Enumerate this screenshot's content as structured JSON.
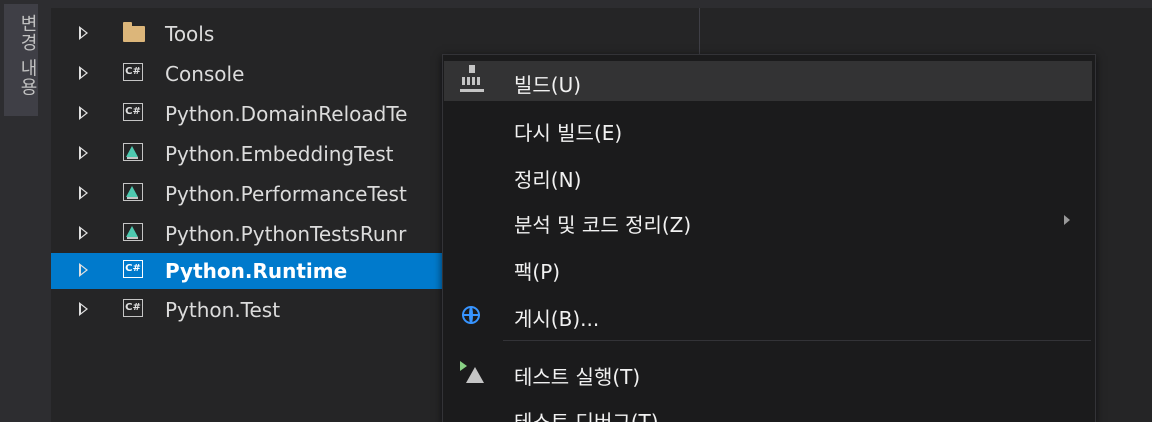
{
  "vertical_tab": {
    "label": "변경 내용"
  },
  "tree": {
    "items": [
      {
        "label": "Tools",
        "icon": "folder-icon",
        "selected": false
      },
      {
        "label": "Console",
        "icon": "csharp-project-icon",
        "selected": false
      },
      {
        "label": "Python.DomainReloadTe",
        "icon": "csharp-project-icon",
        "selected": false
      },
      {
        "label": "Python.EmbeddingTest",
        "icon": "test-project-icon",
        "selected": false
      },
      {
        "label": "Python.PerformanceTest",
        "icon": "test-project-icon",
        "selected": false
      },
      {
        "label": "Python.PythonTestsRunr",
        "icon": "test-project-icon",
        "selected": false
      },
      {
        "label": "Python.Runtime",
        "icon": "csharp-project-icon",
        "selected": true
      },
      {
        "label": "Python.Test",
        "icon": "csharp-project-icon",
        "selected": false
      }
    ],
    "csharp_badge": "C#"
  },
  "context_menu": {
    "items": [
      {
        "label": "빌드(U)",
        "icon": "build-icon",
        "highlighted": true
      },
      {
        "label": "다시 빌드(E)",
        "icon": ""
      },
      {
        "label": "정리(N)",
        "icon": ""
      },
      {
        "label": "분석 및 코드 정리(Z)",
        "icon": "",
        "submenu": true
      },
      {
        "label": "팩(P)",
        "icon": ""
      },
      {
        "label": "게시(B)...",
        "icon": "globe-publish-icon"
      },
      {
        "label": "테스트 실행(T)",
        "icon": "run-tests-icon"
      },
      {
        "label": "테스트 디버그(T)",
        "icon": ""
      }
    ]
  },
  "colors": {
    "selection": "#007acc",
    "menu_background": "#1b1b1c",
    "menu_highlight": "#333334",
    "panel_background": "#252526"
  }
}
